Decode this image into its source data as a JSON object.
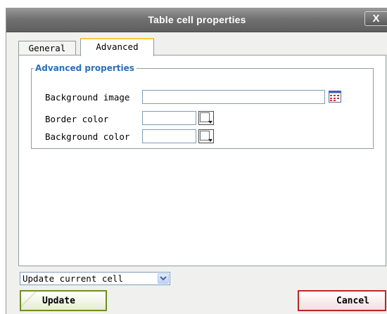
{
  "window": {
    "title": "Table cell properties",
    "close_label": "X"
  },
  "tabs": [
    {
      "label": "General",
      "active": false
    },
    {
      "label": "Advanced",
      "active": true
    }
  ],
  "advanced": {
    "legend": "Advanced properties",
    "fields": {
      "background_image": {
        "label": "Background image",
        "value": ""
      },
      "border_color": {
        "label": "Border color",
        "value": ""
      },
      "background_color": {
        "label": "Background color",
        "value": ""
      }
    }
  },
  "footer": {
    "scope_select": {
      "value": "Update current cell"
    },
    "update_label": "Update",
    "cancel_label": "Cancel"
  },
  "colors": {
    "legend": "#2b6fb6",
    "update_border": "#6f8f1f",
    "cancel_border": "#c02424"
  },
  "icons": {
    "browse": "browse-file-icon",
    "color_picker": "color-picker-icon",
    "dropdown": "chevron-down-icon"
  }
}
